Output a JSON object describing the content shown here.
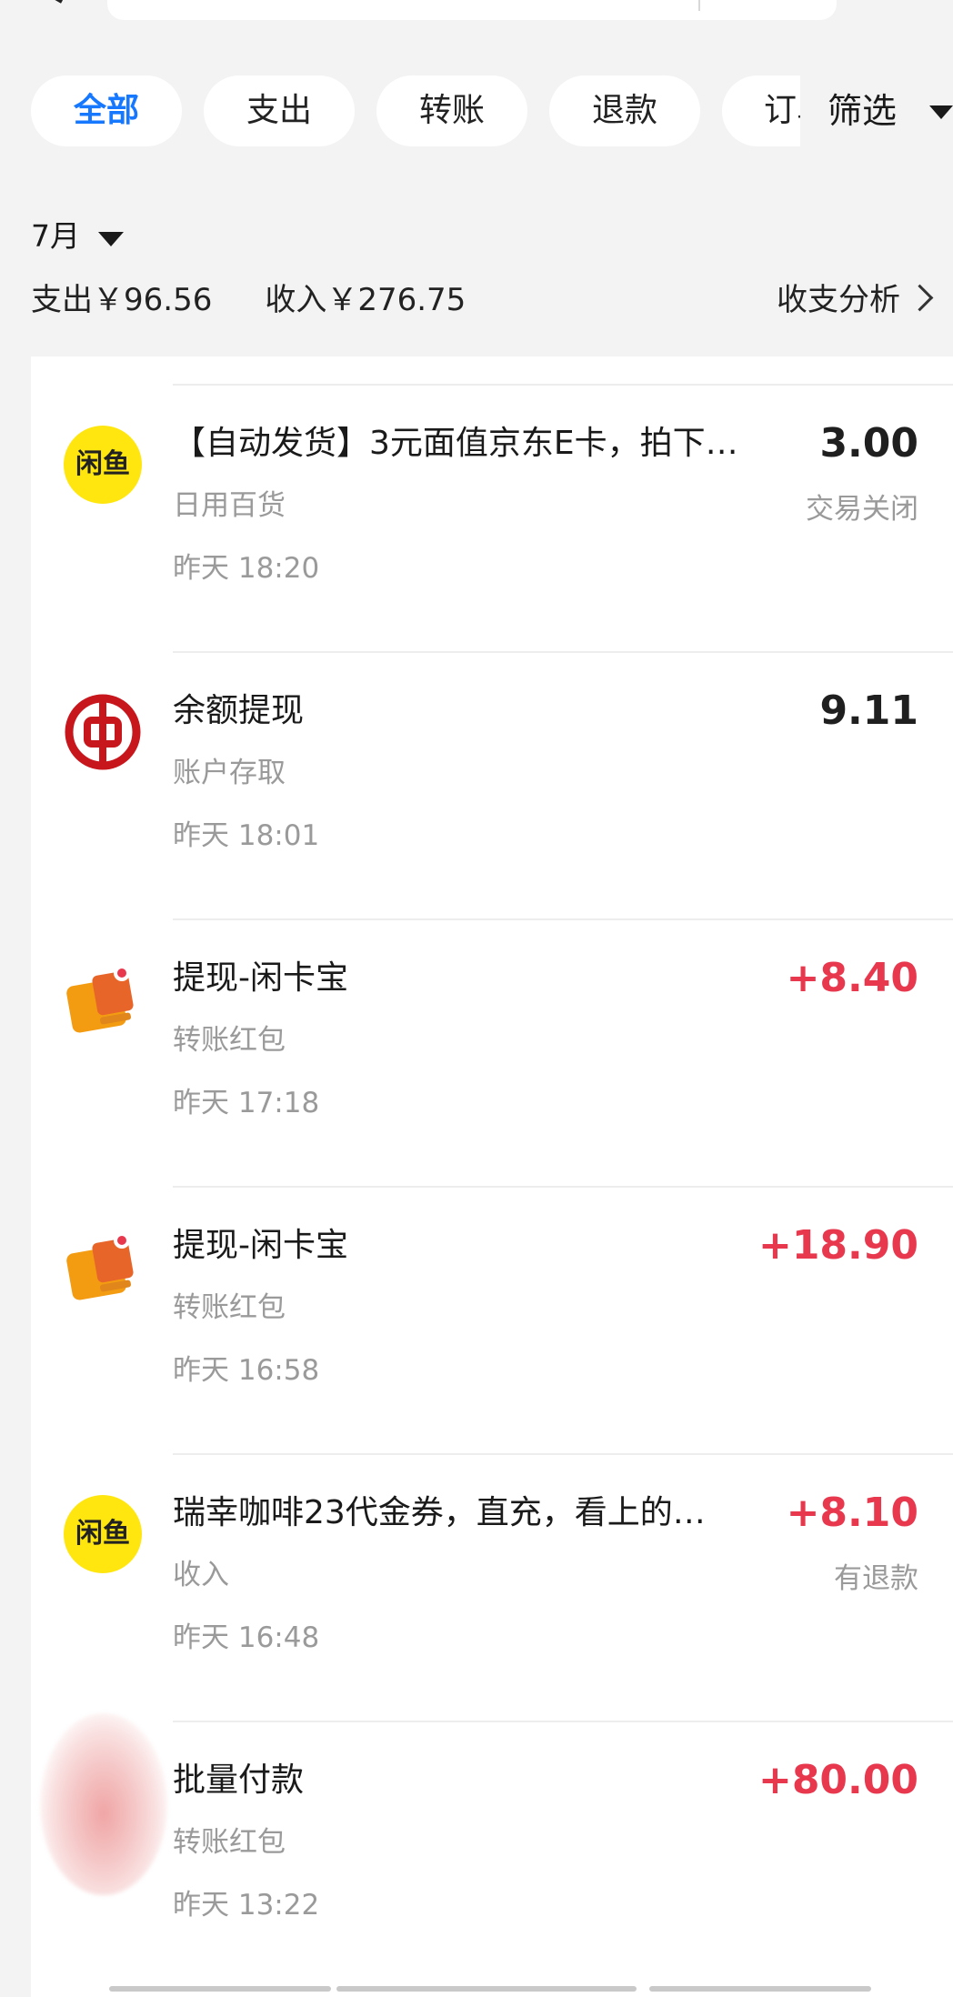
{
  "search": {
    "placeholder": ""
  },
  "tabs": [
    {
      "label": "全部",
      "active": true
    },
    {
      "label": "支出"
    },
    {
      "label": "转账"
    },
    {
      "label": "退款"
    },
    {
      "label": "订单"
    }
  ],
  "filter_label": "筛选",
  "month_label": "7月",
  "summary": {
    "expense": "支出￥96.56",
    "income": "收入￥276.75",
    "analysis_label": "收支分析"
  },
  "transactions": [
    {
      "icon": "xianyu-logo-icon",
      "logo_text": "闲鱼",
      "title": "【自动发货】3元面值京东E卡，拍下…",
      "category": "日用百货",
      "time": "昨天 18:20",
      "amount": "3.00",
      "status": "交易关闭"
    },
    {
      "icon": "bank-of-china-logo-icon",
      "title": "余额提现",
      "category": "账户存取",
      "time": "昨天 18:01",
      "amount": "9.11",
      "status": ""
    },
    {
      "icon": "wallet-icon",
      "title": "提现-闲卡宝",
      "category": "转账红包",
      "time": "昨天 17:18",
      "amount": "+8.40",
      "status": ""
    },
    {
      "icon": "wallet-icon",
      "title": "提现-闲卡宝",
      "category": "转账红包",
      "time": "昨天 16:58",
      "amount": "+18.90",
      "status": ""
    },
    {
      "icon": "xianyu-logo-icon",
      "logo_text": "闲鱼",
      "title": "瑞幸咖啡23代金券，直充，看上的…",
      "category": "收入",
      "time": "昨天 16:48",
      "amount": "+8.10",
      "status": "有退款"
    },
    {
      "icon": "blurred-avatar-icon",
      "title": "批量付款",
      "category": "转账红包",
      "time": "昨天 13:22",
      "amount": "+80.00",
      "status": ""
    }
  ],
  "colors": {
    "accent": "#1677ff",
    "income_red": "#e8384e",
    "xianyu_yellow": "#ffe60f",
    "boc_red": "#c8161d",
    "wallet_orange": "#f39c12"
  }
}
